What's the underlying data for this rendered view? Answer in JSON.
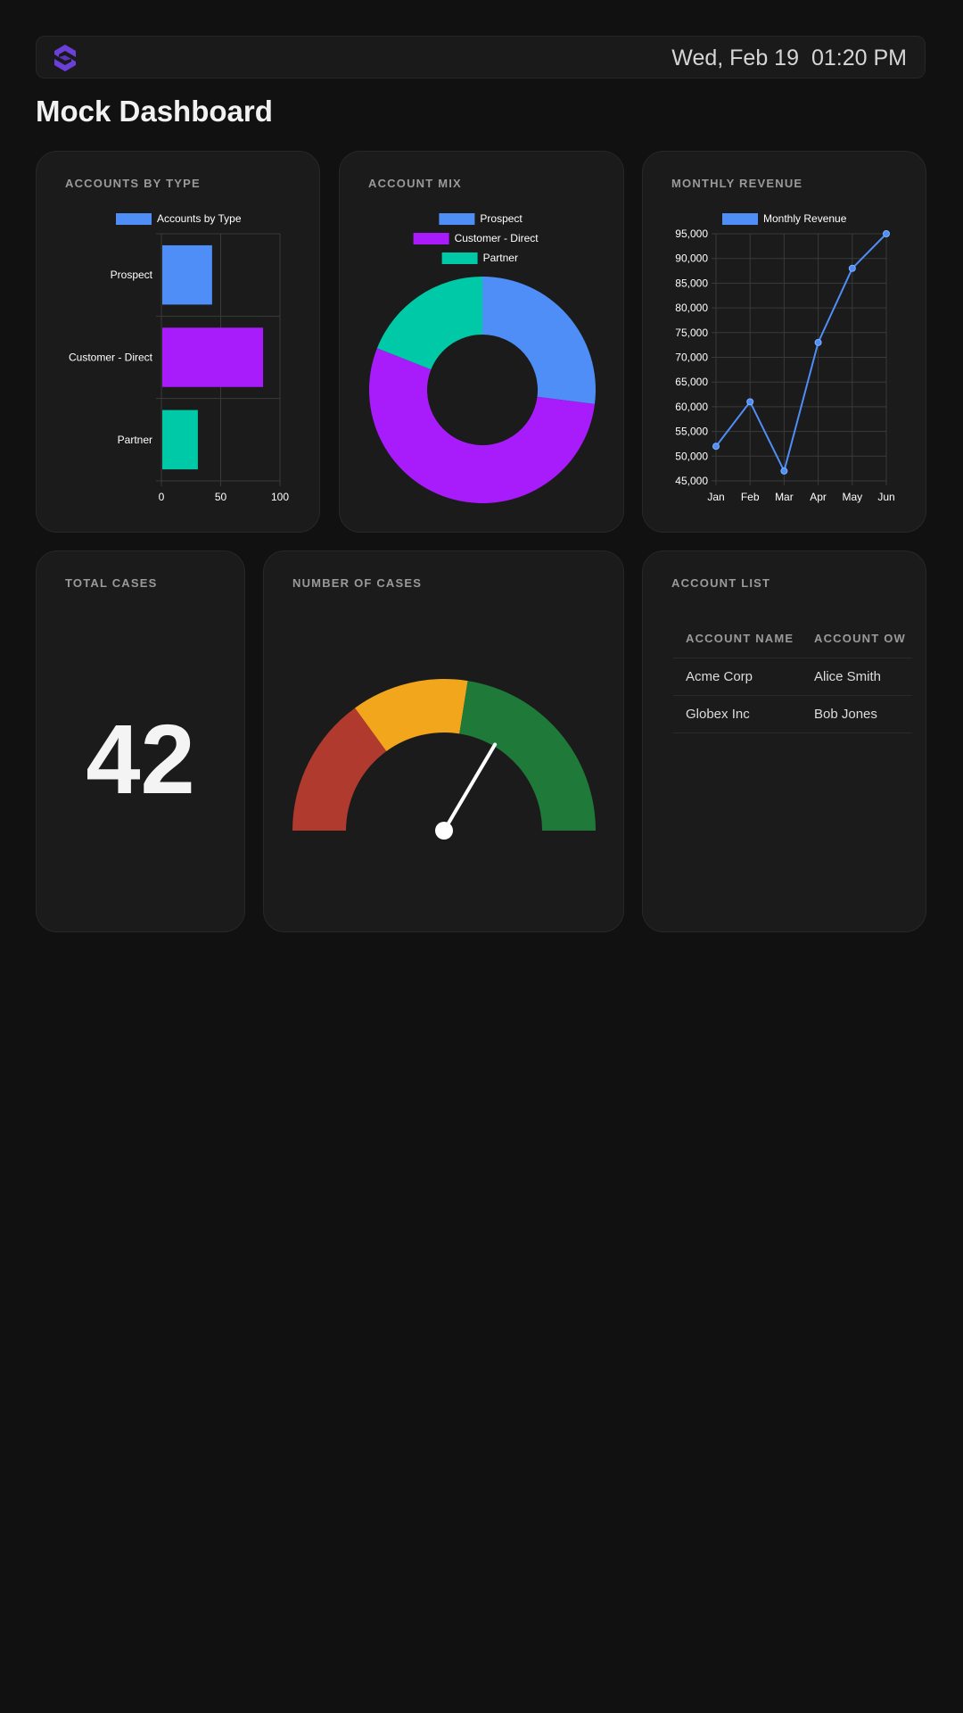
{
  "header": {
    "date": "Wed, Feb 19",
    "time": "01:20 PM",
    "logo_color": "#6b3fd8"
  },
  "page": {
    "title": "Mock Dashboard"
  },
  "cards": {
    "accounts_by_type": {
      "title": "ACCOUNTS BY TYPE"
    },
    "account_mix": {
      "title": "ACCOUNT MIX"
    },
    "monthly_revenue": {
      "title": "MONTHLY REVENUE"
    },
    "total_cases": {
      "title": "TOTAL CASES",
      "value": "42"
    },
    "number_of_cases": {
      "title": "NUMBER OF CASES"
    },
    "account_list": {
      "title": "ACCOUNT LIST",
      "columns": [
        "ACCOUNT NAME",
        "ACCOUNT OW"
      ],
      "rows": [
        [
          "Acme Corp",
          "Alice Smith"
        ],
        [
          "Globex Inc",
          "Bob Jones"
        ]
      ]
    }
  },
  "chart_data": [
    {
      "type": "bar",
      "orientation": "horizontal",
      "categories": [
        "Prospect",
        "Customer - Direct",
        "Partner"
      ],
      "series": [
        {
          "name": "Accounts by Type",
          "values": [
            42,
            85,
            30
          ]
        }
      ],
      "colors": [
        "#4f8ef7",
        "#a81cfb",
        "#00c9a7"
      ],
      "xlim": [
        0,
        100
      ],
      "xticks": [
        0,
        50,
        100
      ],
      "legend": "top",
      "grid": true
    },
    {
      "type": "pie",
      "variant": "doughnut",
      "labels": [
        "Prospect",
        "Customer - Direct",
        "Partner"
      ],
      "values": [
        27,
        54,
        19
      ],
      "colors": [
        "#4f8ef7",
        "#a81cfb",
        "#00c9a7"
      ],
      "legend": "top"
    },
    {
      "type": "line",
      "x": [
        "Jan",
        "Feb",
        "Mar",
        "Apr",
        "May",
        "Jun"
      ],
      "series": [
        {
          "name": "Monthly Revenue",
          "values": [
            52000,
            61000,
            47000,
            73000,
            88000,
            95000
          ]
        }
      ],
      "color": "#4f8ef7",
      "ylim": [
        45000,
        95000
      ],
      "yticks": [
        "45,000",
        "50,000",
        "55,000",
        "60,000",
        "65,000",
        "70,000",
        "75,000",
        "80,000",
        "85,000",
        "90,000",
        "95,000"
      ],
      "legend": "top",
      "grid": true
    },
    {
      "type": "gauge",
      "range": [
        0,
        100
      ],
      "bands": [
        {
          "from": 0,
          "to": 30,
          "color": "#b03a2e"
        },
        {
          "from": 30,
          "to": 55,
          "color": "#f2a61c"
        },
        {
          "from": 55,
          "to": 100,
          "color": "#1f7a3a"
        }
      ],
      "value": 67
    }
  ]
}
